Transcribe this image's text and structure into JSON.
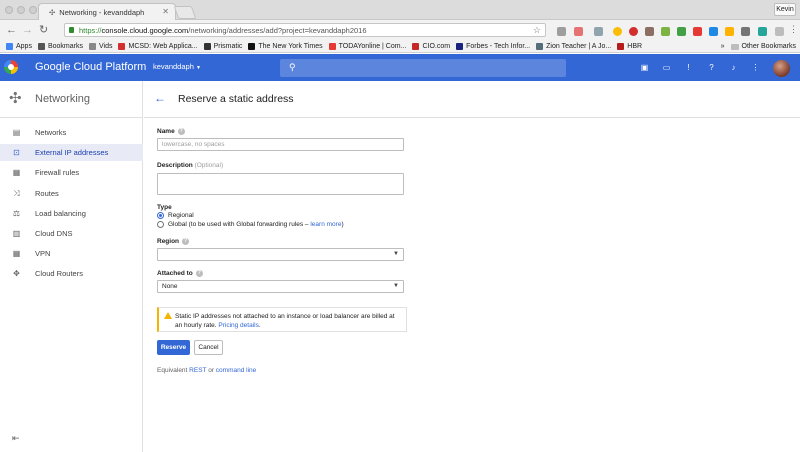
{
  "browser": {
    "tab_title": "Networking - kevanddaph",
    "profile": "Kevin",
    "url_scheme": "https://",
    "url_host": "console.cloud.google.com",
    "url_path": "/networking/addresses/add?project=kevanddaph2016",
    "bookmarks": [
      {
        "label": "Apps",
        "color": "#4285f4"
      },
      {
        "label": "Bookmarks",
        "color": "#555555"
      },
      {
        "label": "Vids",
        "color": "#888888"
      },
      {
        "label": "MCSD: Web Applica...",
        "color": "#d32f2f"
      },
      {
        "label": "Prismatic",
        "color": "#333333"
      },
      {
        "label": "The New York Times",
        "color": "#111111"
      },
      {
        "label": "TODAYonline | Com...",
        "color": "#e53935"
      },
      {
        "label": "CIO.com",
        "color": "#c62828"
      },
      {
        "label": "Forbes - Tech Infor...",
        "color": "#1a237e"
      },
      {
        "label": "Zion Teacher | A Jo...",
        "color": "#546e7a"
      },
      {
        "label": "HBR",
        "color": "#b71c1c"
      }
    ],
    "other_bookmarks": "Other Bookmarks"
  },
  "appbar": {
    "product": "Google Cloud Platform",
    "project": "kevanddaph"
  },
  "sidebar": {
    "title": "Networking",
    "items": [
      {
        "label": "Networks",
        "icon": "networks-icon",
        "glyph": "▤"
      },
      {
        "label": "External IP addresses",
        "icon": "external-ip-icon",
        "glyph": "⊡"
      },
      {
        "label": "Firewall rules",
        "icon": "firewall-icon",
        "glyph": "▦"
      },
      {
        "label": "Routes",
        "icon": "routes-icon",
        "glyph": "⤨"
      },
      {
        "label": "Load balancing",
        "icon": "load-balancing-icon",
        "glyph": "⚖"
      },
      {
        "label": "Cloud DNS",
        "icon": "cloud-dns-icon",
        "glyph": "▥"
      },
      {
        "label": "VPN",
        "icon": "vpn-icon",
        "glyph": "▦"
      },
      {
        "label": "Cloud Routers",
        "icon": "cloud-routers-icon",
        "glyph": "✥"
      }
    ],
    "active_index": 1
  },
  "page": {
    "title": "Reserve a static address",
    "name_label": "Name",
    "name_placeholder": "lowercase, no spaces",
    "description_label": "Description",
    "description_optional": "(Optional)",
    "type_label": "Type",
    "type_options": [
      "Regional",
      "Global (to be used with Global forwarding rules – "
    ],
    "type_learn_more": "learn more",
    "type_close_paren": ")",
    "region_label": "Region",
    "region_value": "",
    "attached_label": "Attached to",
    "attached_value": "None",
    "warning_text": "Static IP addresses not attached to an instance or load balancer are billed at an hourly rate.",
    "warning_link": "Pricing details",
    "warning_period": ".",
    "reserve_label": "Reserve",
    "cancel_label": "Cancel",
    "equivalent_prefix": "Equivalent ",
    "equivalent_rest": "REST",
    "equivalent_or": " or ",
    "equivalent_cli": "command line"
  }
}
